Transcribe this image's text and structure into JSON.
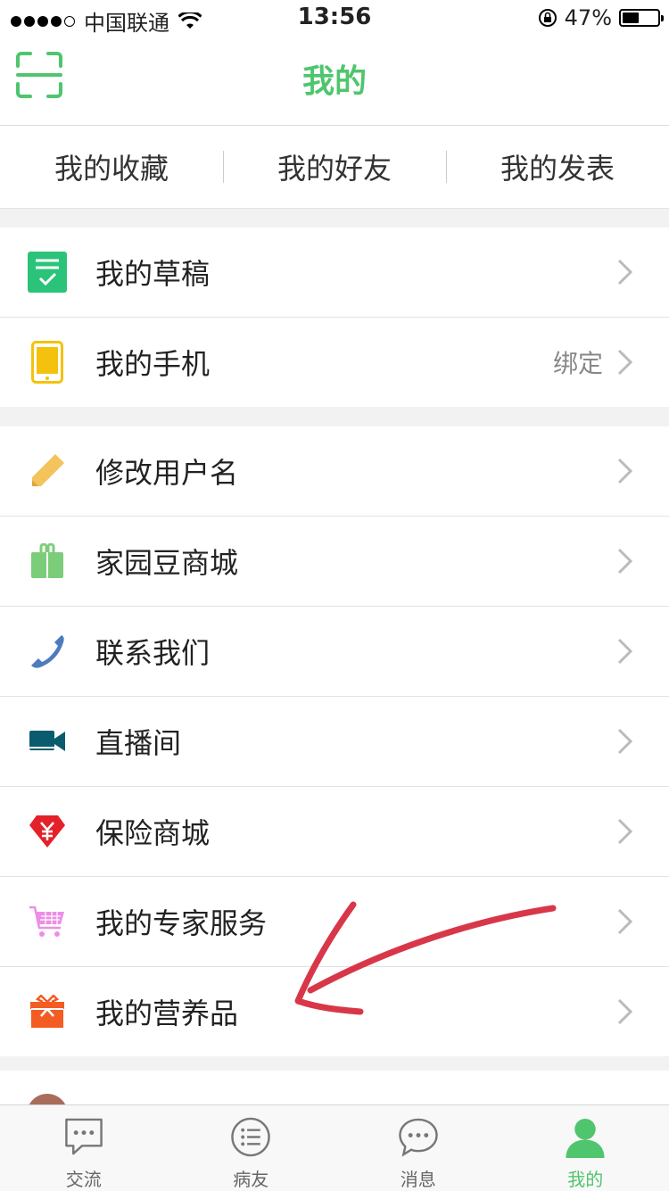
{
  "status_bar": {
    "carrier": "中国联通",
    "time": "13:56",
    "battery": "47%",
    "battery_level": 0.47
  },
  "nav": {
    "title": "我的",
    "left_icon": "scan-icon"
  },
  "tabs": [
    {
      "label": "我的收藏"
    },
    {
      "label": "我的好友"
    },
    {
      "label": "我的发表"
    }
  ],
  "group1": [
    {
      "label": "我的草稿",
      "icon": "draft-icon",
      "color": "#2bc37a"
    },
    {
      "label": "我的手机",
      "icon": "phone-icon",
      "color": "#f4c20d",
      "extra": "绑定"
    }
  ],
  "group2": [
    {
      "label": "修改用户名",
      "icon": "pencil-icon",
      "color": "#f5c35b"
    },
    {
      "label": "家园豆商城",
      "icon": "gift-bag-icon",
      "color": "#7ccd7a"
    },
    {
      "label": "联系我们",
      "icon": "phone-handset-icon",
      "color": "#4d7bbf"
    },
    {
      "label": "直播间",
      "icon": "video-camera-icon",
      "color": "#0b5b6e"
    },
    {
      "label": "保险商城",
      "icon": "yuan-diamond-icon",
      "color": "#e4202a"
    },
    {
      "label": "我的专家服务",
      "icon": "shopping-cart-icon",
      "color": "#ee8de6"
    },
    {
      "label": "我的营养品",
      "icon": "gift-box-icon",
      "color": "#f35c22"
    }
  ],
  "tabbar": [
    {
      "label": "交流",
      "icon": "chat-icon"
    },
    {
      "label": "病友",
      "icon": "list-icon"
    },
    {
      "label": "消息",
      "icon": "message-icon"
    },
    {
      "label": "我的",
      "icon": "profile-icon",
      "active": true
    }
  ],
  "colors": {
    "accent": "#4fc56d",
    "annotation_arrow": "#d8374a"
  }
}
